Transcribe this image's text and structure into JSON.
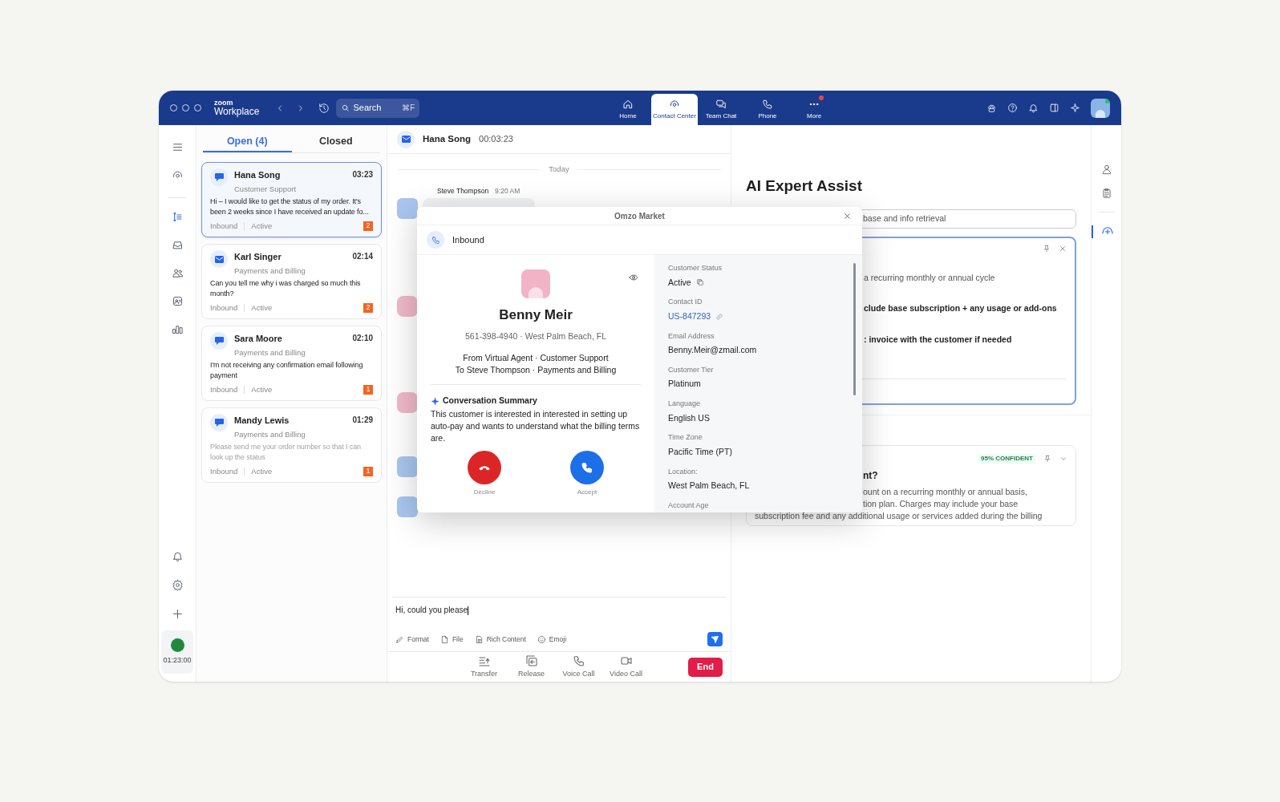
{
  "window": {
    "brand": "zoom",
    "product": "Workplace"
  },
  "toolbar": {
    "search": {
      "placeholder": "Search",
      "shortcut": "⌘F"
    },
    "nav": [
      {
        "label": "Home",
        "kind": "home",
        "selected": false,
        "badge": false
      },
      {
        "label": "Contact Center",
        "kind": "headset",
        "selected": true,
        "badge": false
      },
      {
        "label": "Team Chat",
        "kind": "chat",
        "selected": false,
        "badge": false
      },
      {
        "label": "Phone",
        "kind": "phone",
        "selected": false,
        "badge": false
      },
      {
        "label": "More",
        "kind": "more",
        "selected": false,
        "badge": true
      }
    ]
  },
  "rail": {
    "timer": "01:23:00"
  },
  "list_tabs": [
    {
      "label": "Open (4)",
      "selected": true
    },
    {
      "label": "Closed",
      "selected": false
    }
  ],
  "conversations": [
    {
      "name": "Hana Song",
      "time": "03:23",
      "queue": "Customer Support",
      "message": "Hi – I would like to get the status of my order. It's been 2 weeks since I have received an update fo...",
      "direction": "Inbound",
      "status": "Active",
      "count": "2",
      "kind": "chat",
      "selected": true,
      "muted": false
    },
    {
      "name": "Karl Singer",
      "time": "02:14",
      "queue": "Payments and Billing",
      "message": "Can you tell me why i was charged so much this month?",
      "direction": "Inbound",
      "status": "Active",
      "count": "2",
      "kind": "email",
      "selected": false,
      "muted": false
    },
    {
      "name": "Sara Moore",
      "time": "02:10",
      "queue": "Payments and Billing",
      "message": "I'm not receiving any confirmation email following payment",
      "direction": "Inbound",
      "status": "Active",
      "count": "1",
      "kind": "chat",
      "selected": false,
      "muted": false
    },
    {
      "name": "Mandy Lewis",
      "time": "01:29",
      "queue": "Payments and Billing",
      "message": "Please send me your order number so that I can look up the status",
      "direction": "Inbound",
      "status": "Active",
      "count": "1",
      "kind": "chat",
      "selected": false,
      "muted": true
    }
  ],
  "chat_header": {
    "name": "Hana Song",
    "timer": "00:03:23"
  },
  "chat": {
    "date": "Today",
    "sender": "Steve Thompson",
    "time": "9:20 AM"
  },
  "composer": {
    "value": "Hi, could you please",
    "tools": [
      {
        "label": "Format",
        "kind": "format"
      },
      {
        "label": "File",
        "kind": "file"
      },
      {
        "label": "Rich Content",
        "kind": "rich"
      },
      {
        "label": "Emoji",
        "kind": "emoji"
      }
    ]
  },
  "actions": [
    {
      "label": "Transfer",
      "kind": "transfer"
    },
    {
      "label": "Release",
      "kind": "release"
    },
    {
      "label": "Voice Call",
      "kind": "voice"
    },
    {
      "label": "Video Call",
      "kind": "video"
    }
  ],
  "end_button": "End",
  "popup": {
    "title": "Omzo Market",
    "direction": "Inbound",
    "name": "Benny Meir",
    "subtitle": "561-398-4940 · West Palm Beach, FL",
    "routing": [
      "From Virtual Agent · Customer Support",
      "To Steve Thompson · Payments and Billing"
    ],
    "summary_title": "Conversation Summary",
    "summary": "This customer is interested in interested in setting up auto-pay and wants to understand what the billing terms are.",
    "buttons": [
      {
        "label": "Decline",
        "kind": "decline"
      },
      {
        "label": "Accept",
        "kind": "accept"
      }
    ],
    "fields": [
      {
        "label": "Customer Status",
        "value": "Active",
        "kind": "copy"
      },
      {
        "label": "Contact ID",
        "value": "US-847293",
        "kind": "link"
      },
      {
        "label": "Email Address",
        "value": "Benny.Meir@zmail.com",
        "kind": "text"
      },
      {
        "label": "Customer Tier",
        "value": "Platinum",
        "kind": "text"
      },
      {
        "label": "Language",
        "value": "English US",
        "kind": "text"
      },
      {
        "label": "Time Zone",
        "value": "Pacific Time (PT)",
        "kind": "text"
      },
      {
        "label": "Location:",
        "value": "West Palm Beach, FL",
        "kind": "text"
      },
      {
        "label": "Account Age"
      }
    ]
  },
  "ai": {
    "title": "AI Expert Assist",
    "search_value": "base and info retrieval",
    "card_lines": [
      {
        "text": "a recurring monthly or annual cycle",
        "bold": false
      },
      {
        "text": "clude base subscription + any usage or add-ons",
        "bold": true
      },
      {
        "text": ": invoice with the customer if needed",
        "bold": true
      }
    ],
    "answer": {
      "confidence": "95% CONFIDENT",
      "question": "nt?",
      "lines": [
        "ount on a recurring monthly or annual basis,",
        "tion plan. Charges may include your base",
        "subscription fee and any additional usage or services added during the billing"
      ]
    }
  }
}
